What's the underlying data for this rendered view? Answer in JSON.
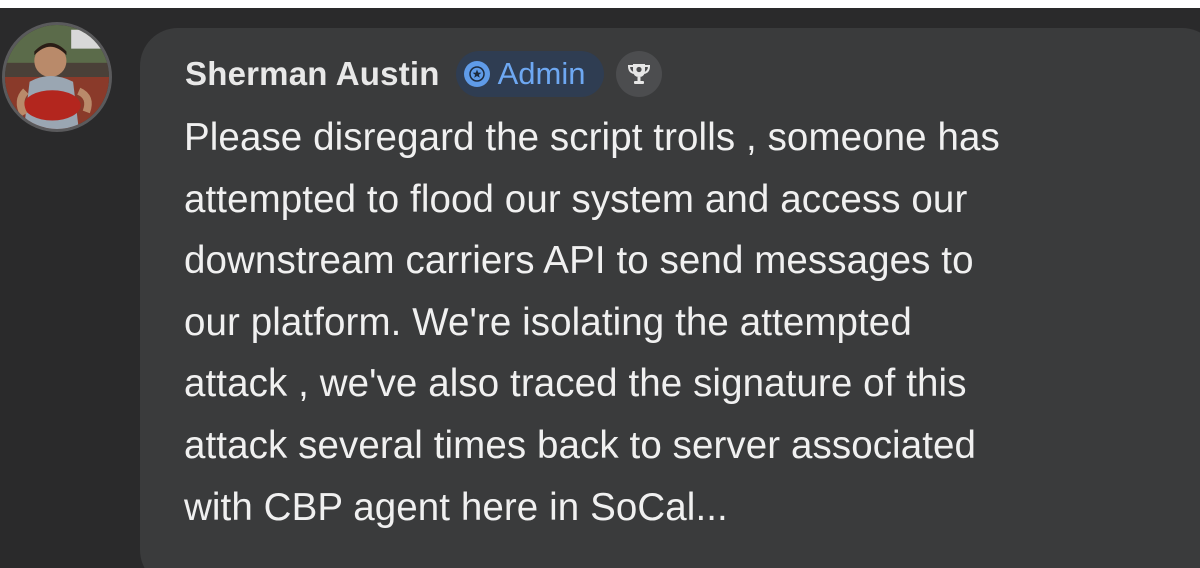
{
  "comment": {
    "author": {
      "name": "Sherman Austin",
      "role_badge": "Admin",
      "avatar_icon": "profile-photo"
    },
    "badge_icons": [
      "star-icon",
      "trophy-icon"
    ],
    "message_lines": [
      "Please disregard the script trolls , someone has",
      "attempted to flood our system and access our",
      "downstream carriers API to send messages to",
      "our platform. We're isolating the attempted",
      "attack , we've also traced the signature of this",
      "attack several times back to server associated",
      "with CBP agent here in SoCal..."
    ]
  },
  "colors": {
    "background": "#2a2a2b",
    "bubble": "#3a3b3c",
    "name_text": "#e8e8e8",
    "message_text": "#f0f0f0",
    "admin_badge_bg": "#2f3d52",
    "admin_accent": "#6ea8f2"
  }
}
